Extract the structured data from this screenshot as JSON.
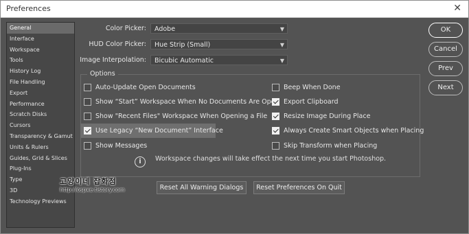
{
  "window": {
    "title": "Preferences",
    "close_glyph": "✕"
  },
  "sidebar": {
    "items": [
      {
        "label": "General"
      },
      {
        "label": "Interface"
      },
      {
        "label": "Workspace"
      },
      {
        "label": "Tools"
      },
      {
        "label": "History Log"
      },
      {
        "label": "File Handling"
      },
      {
        "label": "Export"
      },
      {
        "label": "Performance"
      },
      {
        "label": "Scratch Disks"
      },
      {
        "label": "Cursors"
      },
      {
        "label": "Transparency & Gamut"
      },
      {
        "label": "Units & Rulers"
      },
      {
        "label": "Guides, Grid & Slices"
      },
      {
        "label": "Plug-Ins"
      },
      {
        "label": "Type"
      },
      {
        "label": "3D"
      },
      {
        "label": "Technology Previews"
      }
    ]
  },
  "fields": {
    "color_picker": {
      "label": "Color Picker:",
      "value": "Adobe"
    },
    "hud_color_picker": {
      "label": "HUD Color Picker:",
      "value": "Hue Strip (Small)"
    },
    "image_interpolation": {
      "label": "Image Interpolation:",
      "value": "Bicubic Automatic"
    }
  },
  "options": {
    "legend": "Options",
    "left": [
      {
        "label": "Auto-Update Open Documents",
        "checked": false
      },
      {
        "label": "Show “Start” Workspace When No Documents Are Open",
        "checked": false
      },
      {
        "label": "Show \"Recent Files\" Workspace When Opening a File",
        "checked": false
      },
      {
        "label": "Use Legacy “New Document” Interface",
        "checked": true
      },
      {
        "label": "Show Messages",
        "checked": false
      }
    ],
    "right": [
      {
        "label": "Beep When Done",
        "checked": false
      },
      {
        "label": "Export Clipboard",
        "checked": true
      },
      {
        "label": "Resize Image During Place",
        "checked": true
      },
      {
        "label": "Always Create Smart Objects when Placing",
        "checked": true
      },
      {
        "label": "Skip Transform when Placing",
        "checked": false
      }
    ],
    "info_icon": "i",
    "info_text": "Workspace changes will take effect the next time you start Photoshop."
  },
  "buttons": {
    "reset_warnings": "Reset All Warning Dialogs",
    "reset_prefs": "Reset Preferences On Quit",
    "ok": "OK",
    "cancel": "Cancel",
    "prev": "Prev",
    "next": "Next"
  },
  "watermark": {
    "line1": "고양이네 잡화점",
    "line2": "http://ospxe.tistory.com"
  },
  "colors": {
    "background": "#535353",
    "sidebar": "#474747",
    "selected": "#6a6a6a"
  }
}
